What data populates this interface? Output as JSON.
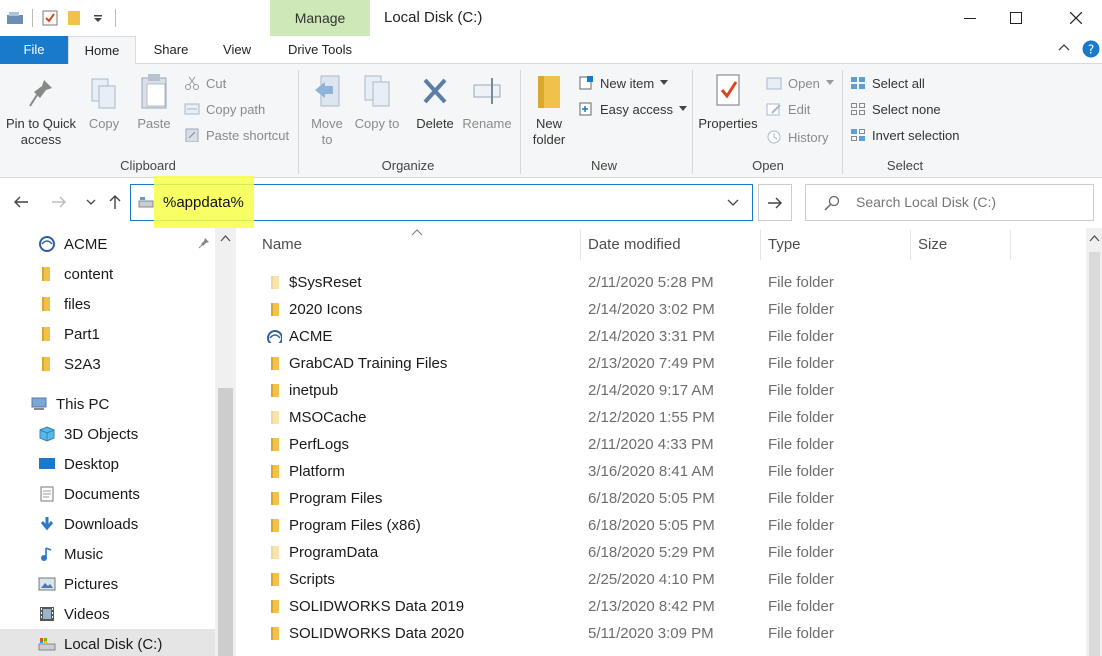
{
  "window": {
    "title": "Local Disk (C:)",
    "context_tab": "Manage"
  },
  "ribbon_tabs": [
    "File",
    "Home",
    "Share",
    "View",
    "Drive Tools"
  ],
  "ribbon": {
    "clipboard": {
      "label": "Clipboard",
      "pin": "Pin to Quick access",
      "copy": "Copy",
      "paste": "Paste",
      "cut": "Cut",
      "copy_path": "Copy path",
      "paste_shortcut": "Paste shortcut"
    },
    "organize": {
      "label": "Organize",
      "move_to": "Move to",
      "copy_to": "Copy to",
      "delete": "Delete",
      "rename": "Rename"
    },
    "new": {
      "label": "New",
      "new_folder": "New folder",
      "new_item": "New item",
      "easy_access": "Easy access"
    },
    "open": {
      "label": "Open",
      "properties": "Properties",
      "open": "Open",
      "edit": "Edit",
      "history": "History"
    },
    "select": {
      "label": "Select",
      "select_all": "Select all",
      "select_none": "Select none",
      "invert": "Invert selection"
    }
  },
  "address": {
    "value": "%appdata%"
  },
  "search": {
    "placeholder": "Search Local Disk (C:)"
  },
  "sidebar": [
    {
      "label": "ACME",
      "icon": "acme-icon"
    },
    {
      "label": "content",
      "icon": "folder-icon"
    },
    {
      "label": "files",
      "icon": "folder-icon"
    },
    {
      "label": "Part1",
      "icon": "folder-icon"
    },
    {
      "label": "S2A3",
      "icon": "folder-icon"
    },
    {
      "label": "This PC",
      "icon": "computer-icon"
    },
    {
      "label": "3D Objects",
      "icon": "cube-icon"
    },
    {
      "label": "Desktop",
      "icon": "desktop-icon"
    },
    {
      "label": "Documents",
      "icon": "documents-icon"
    },
    {
      "label": "Downloads",
      "icon": "download-icon"
    },
    {
      "label": "Music",
      "icon": "music-icon"
    },
    {
      "label": "Pictures",
      "icon": "pictures-icon"
    },
    {
      "label": "Videos",
      "icon": "videos-icon"
    },
    {
      "label": "Local Disk (C:)",
      "icon": "drive-icon"
    }
  ],
  "columns": {
    "name": "Name",
    "date": "Date modified",
    "type": "Type",
    "size": "Size"
  },
  "files": [
    {
      "name": "$SysReset",
      "date": "2/11/2020 5:28 PM",
      "type": "File folder"
    },
    {
      "name": "2020 Icons",
      "date": "2/14/2020 3:02 PM",
      "type": "File folder"
    },
    {
      "name": "ACME",
      "date": "2/14/2020 3:31 PM",
      "type": "File folder"
    },
    {
      "name": "GrabCAD Training Files",
      "date": "2/13/2020 7:49 PM",
      "type": "File folder"
    },
    {
      "name": "inetpub",
      "date": "2/14/2020 9:17 AM",
      "type": "File folder"
    },
    {
      "name": "MSOCache",
      "date": "2/12/2020 1:55 PM",
      "type": "File folder"
    },
    {
      "name": "PerfLogs",
      "date": "2/11/2020 4:33 PM",
      "type": "File folder"
    },
    {
      "name": "Platform",
      "date": "3/16/2020 8:41 AM",
      "type": "File folder"
    },
    {
      "name": "Program Files",
      "date": "6/18/2020 5:05 PM",
      "type": "File folder"
    },
    {
      "name": "Program Files (x86)",
      "date": "6/18/2020 5:05 PM",
      "type": "File folder"
    },
    {
      "name": "ProgramData",
      "date": "6/18/2020 5:29 PM",
      "type": "File folder"
    },
    {
      "name": "Scripts",
      "date": "2/25/2020 4:10 PM",
      "type": "File folder"
    },
    {
      "name": "SOLIDWORKS Data 2019",
      "date": "2/13/2020 8:42 PM",
      "type": "File folder"
    },
    {
      "name": "SOLIDWORKS Data 2020",
      "date": "5/11/2020 3:09 PM",
      "type": "File folder"
    }
  ],
  "colors": {
    "accent": "#1979ca",
    "folder": "#f0c24b",
    "manage_tab": "#cfe8b8",
    "highlight": "#f7ff4a"
  }
}
